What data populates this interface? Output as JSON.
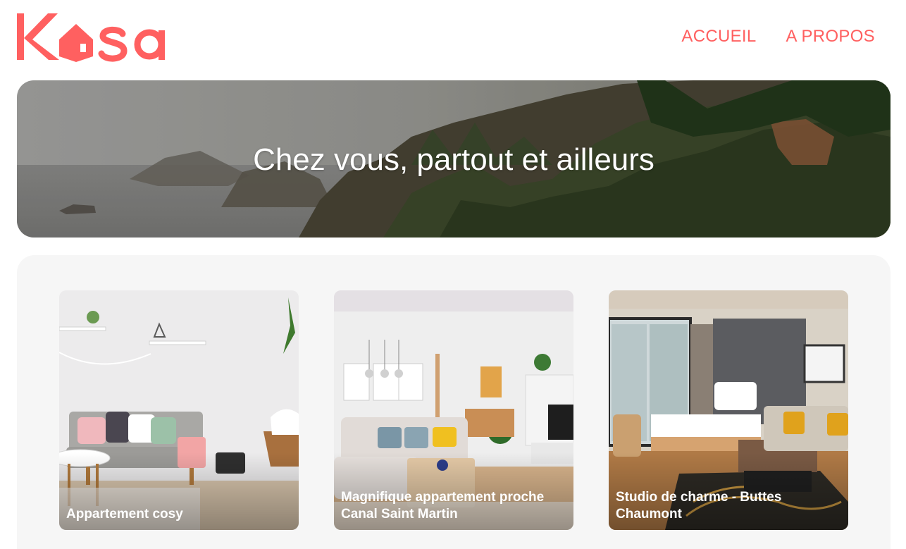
{
  "brand": {
    "logo_text": "Kasa",
    "accent_color": "#ff6060"
  },
  "nav": {
    "items": [
      {
        "label": "ACCUEIL"
      },
      {
        "label": "A PROPOS"
      }
    ]
  },
  "banner": {
    "title": "Chez vous, partout et ailleurs"
  },
  "gallery": {
    "background_color": "#f6f6f6",
    "cards": [
      {
        "title": "Appartement cosy"
      },
      {
        "title": "Magnifique appartement proche Canal Saint Martin"
      },
      {
        "title": "Studio de charme - Buttes Chaumont"
      }
    ]
  }
}
